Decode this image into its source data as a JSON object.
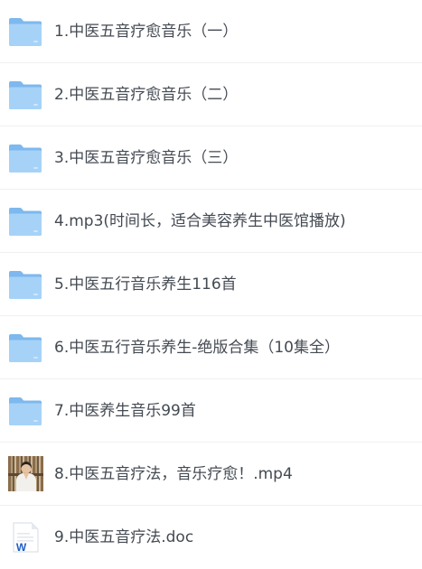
{
  "files": [
    {
      "name": "1.中医五音疗愈音乐（一）",
      "type": "folder",
      "icon": "folder-icon"
    },
    {
      "name": "2.中医五音疗愈音乐（二）",
      "type": "folder",
      "icon": "folder-icon"
    },
    {
      "name": "3.中医五音疗愈音乐（三）",
      "type": "folder",
      "icon": "folder-icon"
    },
    {
      "name": "4.mp3(时间长，适合美容养生中医馆播放)",
      "type": "folder",
      "icon": "folder-icon"
    },
    {
      "name": "5.中医五行音乐养生116首",
      "type": "folder",
      "icon": "folder-icon"
    },
    {
      "name": "6.中医五行音乐养生-绝版合集（10集全）",
      "type": "folder",
      "icon": "folder-icon"
    },
    {
      "name": "7.中医养生音乐99首",
      "type": "folder",
      "icon": "folder-icon"
    },
    {
      "name": "8.中医五音疗法，音乐疗愈！.mp4",
      "type": "video",
      "icon": "video-thumbnail"
    },
    {
      "name": "9.中医五音疗法.doc",
      "type": "doc",
      "icon": "word-doc-icon"
    }
  ],
  "colors": {
    "folder_back": "#7db8ee",
    "folder_front": "#a6d2f8",
    "text": "#444a52",
    "divider": "#f0f0f2",
    "word_blue": "#1f5fc4"
  }
}
